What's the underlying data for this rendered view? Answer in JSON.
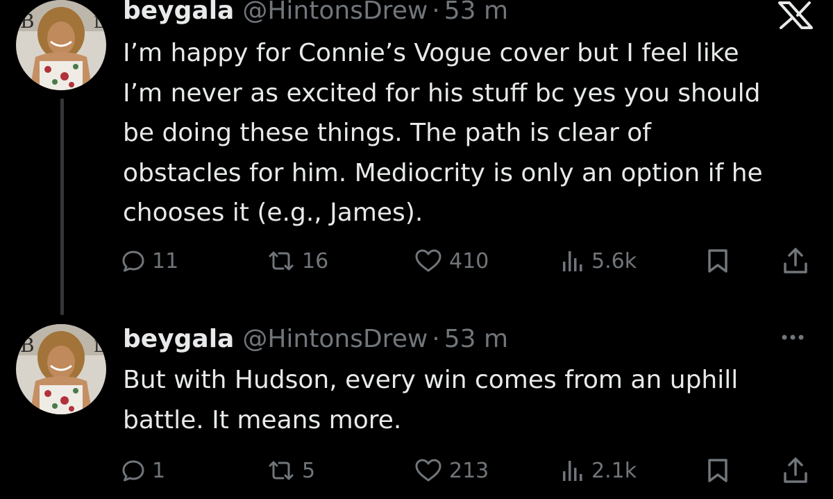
{
  "tweets": [
    {
      "display_name": "beygala",
      "handle": "@HintonsDrew",
      "separator": "·",
      "time": "53 m",
      "text": "I’m happy for Connie’s Vogue cover but I feel like\nI’m never as excited for his stuff bc yes you should\nbe doing these things. The path is clear of\nobstacles for him. Mediocrity is only an option if he\nchooses it (e.g., James).",
      "replies": "11",
      "reposts": "16",
      "likes": "410",
      "views": "5.6k",
      "icons": [
        "reply-icon",
        "repost-icon",
        "like-icon",
        "views-icon",
        "bookmark-icon",
        "share-icon"
      ]
    },
    {
      "display_name": "beygala",
      "handle": "@HintonsDrew",
      "separator": "·",
      "time": "53 m",
      "text": "But with Hudson, every win comes from an uphill\nbattle. It means more.",
      "replies": "1",
      "reposts": "5",
      "likes": "213",
      "views": "2.1k",
      "icons": [
        "reply-icon",
        "repost-icon",
        "like-icon",
        "views-icon",
        "bookmark-icon",
        "share-icon"
      ]
    }
  ],
  "top_right_icon": "x-logo-icon",
  "more_icon": "more-icon",
  "colors": {
    "background": "#000000",
    "primary_text": "#e7e9ea",
    "secondary_text": "#71767b",
    "thread_line": "#333639"
  }
}
